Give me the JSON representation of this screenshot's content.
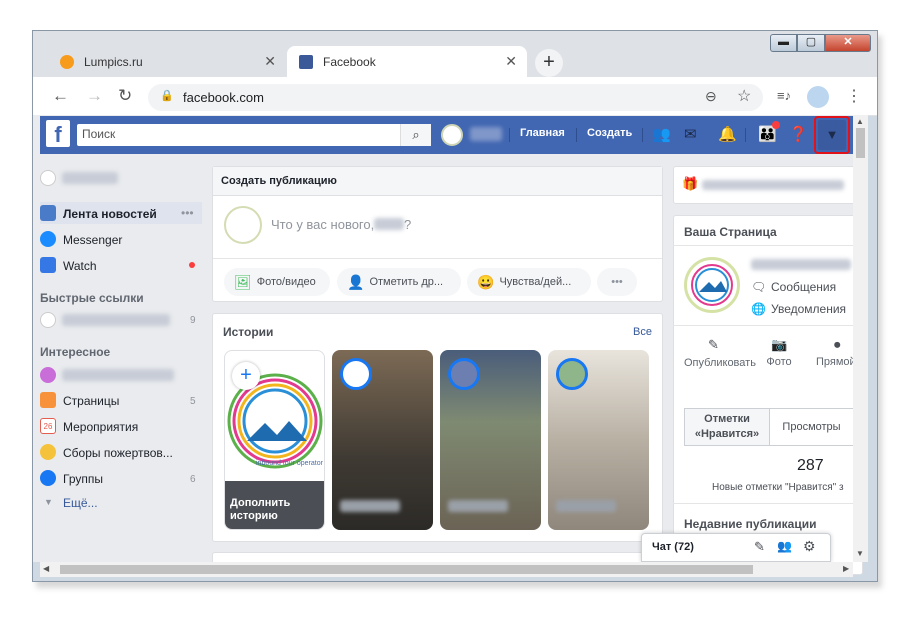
{
  "browser": {
    "tabs": [
      {
        "title": "Lumpics.ru",
        "close": "✕"
      },
      {
        "title": "Facebook",
        "close": "✕"
      }
    ],
    "new_tab": "+",
    "window_controls": {
      "minimize": "▬",
      "maximize": "▢",
      "close": "✕"
    },
    "url": "facebook.com"
  },
  "fb_header": {
    "logo": "f",
    "search_placeholder": "Поиск",
    "links": {
      "home": "Главная",
      "create": "Создать"
    },
    "icons": [
      "friends-icon",
      "messenger-icon",
      "notifications-icon",
      "groups-icon",
      "help-icon",
      "dropdown-caret-icon"
    ]
  },
  "sidebar": {
    "items": [
      {
        "label": "Лента новостей",
        "more": "•••"
      },
      {
        "label": "Messenger"
      },
      {
        "label": "Watch"
      }
    ],
    "quick_links_header": "Быстрые ссылки",
    "quick_links_count": "9",
    "interests_header": "Интересное",
    "interests": [
      {
        "label": "Страницы",
        "count": "5"
      },
      {
        "label": "Мероприятия",
        "count": ""
      },
      {
        "label": "Сборы пожертвов...",
        "count": ""
      },
      {
        "label": "Группы",
        "count": "6"
      },
      {
        "label": "Ещё...",
        "count": ""
      }
    ]
  },
  "composer": {
    "title": "Создать публикацию",
    "placeholder_start": "Что у вас нового,",
    "placeholder_end": "?",
    "chips": [
      "Фото/видео",
      "Отметить др...",
      "Чувства/дей..."
    ],
    "more": "•••"
  },
  "stories": {
    "title": "Истории",
    "all": "Все",
    "add_label": "Дополнить историю",
    "add_icon": "+",
    "banner_text": "inbound tour operator"
  },
  "right": {
    "your_page": "Ваша Страница",
    "messages": "Сообщения",
    "notifications": "Уведомления",
    "actions": [
      "Опубликовать",
      "Фото",
      "Прямой эфир"
    ],
    "tabs": [
      "Отметки «Нравится»",
      "Просмотры"
    ],
    "likes_count": "287",
    "likes_label": "Новые отметки \"Нравится\" з",
    "recent_posts": "Недавние публикации"
  },
  "chat": {
    "label": "Чат (72)"
  }
}
